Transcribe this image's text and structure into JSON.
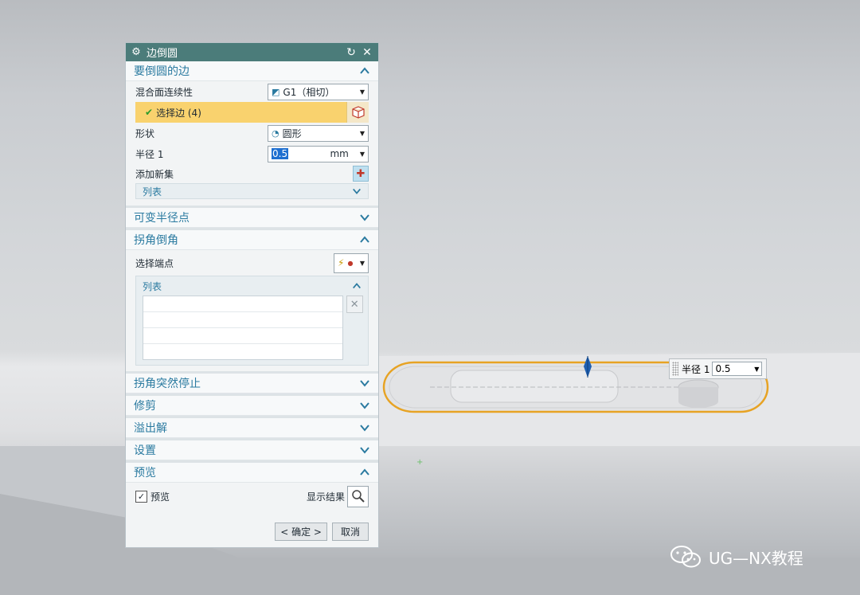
{
  "dialog": {
    "title": "边倒圆",
    "sections": {
      "edges": {
        "title": "要倒圆的边",
        "continuity_label": "混合面连续性",
        "continuity_value": "G1（相切）",
        "select_label": "选择边 (4)",
        "shape_label": "形状",
        "shape_value": "圆形",
        "radius_label": "半径 1",
        "radius_value": "0.5",
        "radius_unit": "mm",
        "add_set_label": "添加新集",
        "list_label": "列表"
      },
      "variable": {
        "title": "可变半径点"
      },
      "corner": {
        "title": "拐角倒角",
        "select_end_label": "选择端点",
        "list_label": "列表"
      },
      "corner_stop": {
        "title": "拐角突然停止"
      },
      "trim": {
        "title": "修剪"
      },
      "overflow": {
        "title": "溢出解"
      },
      "settings": {
        "title": "设置"
      },
      "preview": {
        "title": "预览",
        "preview_check": "预览",
        "show_result": "显示结果"
      }
    },
    "buttons": {
      "ok": "< 确定 >",
      "cancel": "取消"
    }
  },
  "floating_input": {
    "label": "半径 1",
    "value": "0.5"
  },
  "watermark": {
    "text": "UG—NX教程"
  },
  "colors": {
    "title_bar": "#4b7c7a",
    "section_header": "#2a7aa0",
    "selection_highlight": "#f9d26e",
    "edge_highlight": "#e7a324"
  }
}
